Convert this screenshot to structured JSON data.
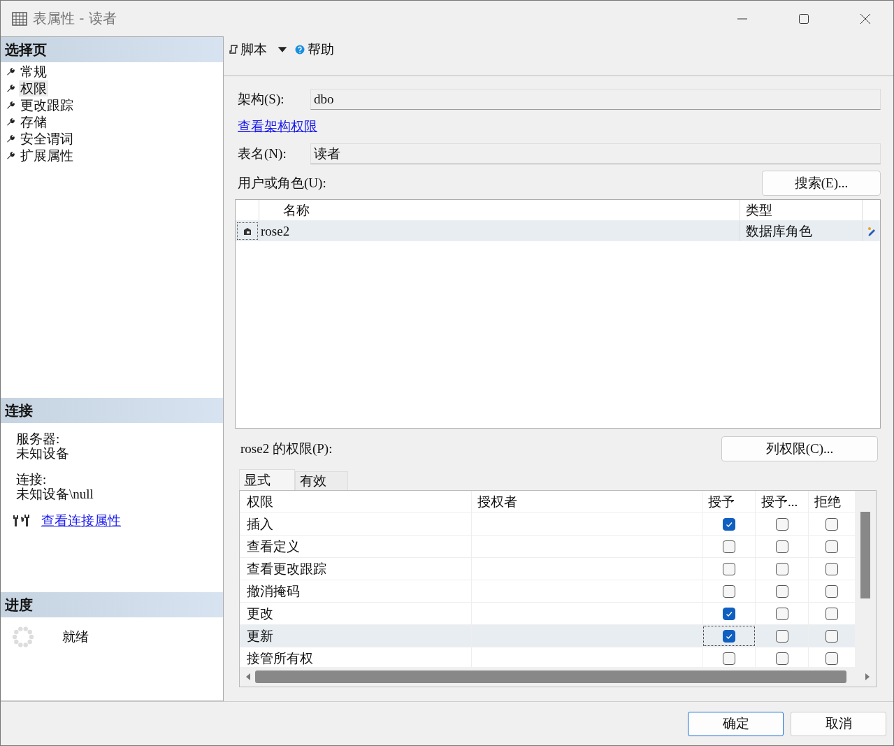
{
  "window": {
    "title": "表属性 - 读者"
  },
  "sidebar": {
    "header": "选择页",
    "items": [
      {
        "label": "常规",
        "selected": false
      },
      {
        "label": "权限",
        "selected": true
      },
      {
        "label": "更改跟踪",
        "selected": false
      },
      {
        "label": "存储",
        "selected": false
      },
      {
        "label": "安全谓词",
        "selected": false
      },
      {
        "label": "扩展属性",
        "selected": false
      }
    ]
  },
  "connection": {
    "header": "连接",
    "server_label": "服务器:",
    "server": "未知设备",
    "connection_label": "连接:",
    "connection": "未知设备\\null",
    "link": "查看连接属性"
  },
  "progress": {
    "header": "进度",
    "status": "就绪"
  },
  "toolbar": [
    {
      "label": "脚本",
      "kind": "script"
    },
    {
      "label": "帮助",
      "kind": "help"
    }
  ],
  "schema": {
    "label": "架构(S):",
    "value": "dbo"
  },
  "schema_link": "查看架构权限",
  "table_name": {
    "label": "表名(N):",
    "value": "读者"
  },
  "users": {
    "label": "用户或角色(U):",
    "search_button": "搜索(E)...",
    "columns": [
      "名称",
      "类型"
    ],
    "rows": [
      {
        "name": "rose2",
        "type": "数据库角色",
        "selected": true
      }
    ]
  },
  "permissions": {
    "label": "rose2 的权限(P):",
    "column_button": "列权限(C)...",
    "tabs": [
      {
        "label": "显式",
        "selected": true
      },
      {
        "label": "有效",
        "selected": false
      }
    ],
    "columns": [
      "权限",
      "授权者",
      "授予",
      "授予...",
      "拒绝"
    ],
    "rows": [
      {
        "permission": "插入",
        "grant": true,
        "with_grant": false,
        "deny": false,
        "selected": false
      },
      {
        "permission": "查看定义",
        "grant": false,
        "with_grant": false,
        "deny": false,
        "selected": false
      },
      {
        "permission": "查看更改跟踪",
        "grant": false,
        "with_grant": false,
        "deny": false,
        "selected": false
      },
      {
        "permission": "撤消掩码",
        "grant": false,
        "with_grant": false,
        "deny": false,
        "selected": false
      },
      {
        "permission": "更改",
        "grant": true,
        "with_grant": false,
        "deny": false,
        "selected": false
      },
      {
        "permission": "更新",
        "grant": true,
        "with_grant": false,
        "deny": false,
        "selected": true
      },
      {
        "permission": "接管所有权",
        "grant": false,
        "with_grant": false,
        "deny": false,
        "selected": false
      }
    ]
  },
  "buttons": [
    {
      "label": "确定",
      "kind": "default"
    },
    {
      "label": "取消",
      "kind": "normal"
    }
  ]
}
